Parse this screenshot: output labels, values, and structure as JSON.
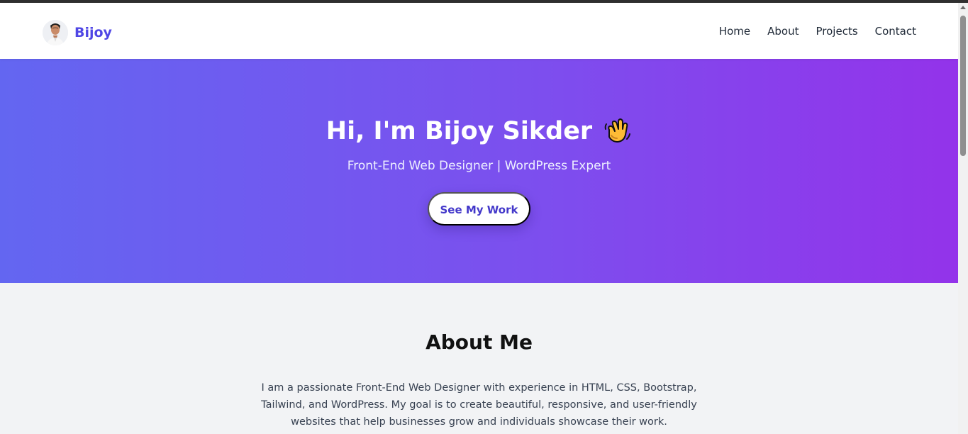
{
  "brand": {
    "name": "Bijoy",
    "avatar_icon": "person-avatar-icon"
  },
  "nav": {
    "items": [
      {
        "label": "Home"
      },
      {
        "label": "About"
      },
      {
        "label": "Projects"
      },
      {
        "label": "Contact"
      }
    ]
  },
  "hero": {
    "title": "Hi, I'm Bijoy Sikder",
    "title_icon": "waving-hand-icon",
    "subtitle": "Front-End Web Designer | WordPress Expert",
    "button_label": "See My Work",
    "gradient_start": "#6366f1",
    "gradient_end": "#9333ea"
  },
  "about": {
    "title": "About Me",
    "text": "I am a passionate Front-End Web Designer with experience in HTML, CSS, Bootstrap, Tailwind, and WordPress. My goal is to create beautiful, responsive, and user-friendly websites that help businesses grow and individuals showcase their work."
  },
  "colors": {
    "brand_accent": "#4f46e5",
    "button_text": "#4338ca",
    "section_background": "#f2f3f5"
  }
}
